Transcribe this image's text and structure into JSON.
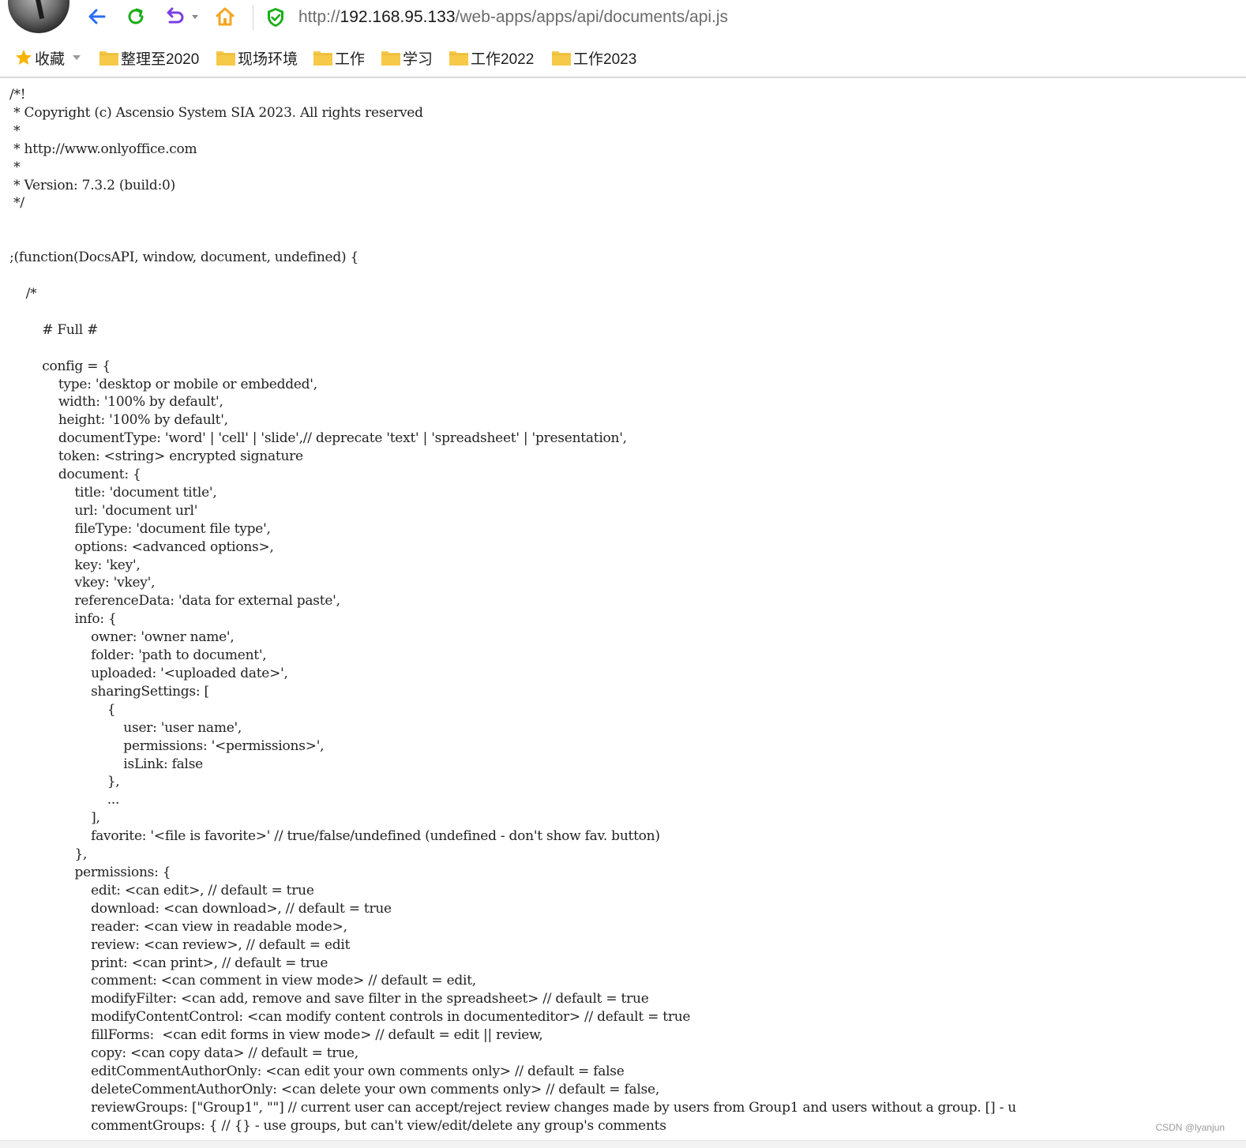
{
  "browser": {
    "url_scheme": "http://",
    "url_host": "192.168.95.133",
    "url_path": "/web-apps/apps/api/documents/api.js"
  },
  "bookmarks": {
    "favorites_label": "收藏",
    "items": [
      "整理至2020",
      "现场环境",
      "工作",
      "学习",
      "工作2022",
      "工作2023"
    ]
  },
  "colors": {
    "back": "#2a6df4",
    "refresh": "#1aad19",
    "undo": "#7b3fe4",
    "home": "#f5a623",
    "shield": "#1aad19",
    "folder": "#f7c948",
    "star": "#f7b500"
  },
  "source_lines": [
    "/*!",
    " * Copyright (c) Ascensio System SIA 2023. All rights reserved",
    " *",
    " * http://www.onlyoffice.com",
    " *",
    " * Version: 7.3.2 (build:0)",
    " */",
    "",
    "",
    ";(function(DocsAPI, window, document, undefined) {",
    "",
    "    /*",
    "",
    "        # Full #",
    "",
    "        config = {",
    "            type: 'desktop or mobile or embedded',",
    "            width: '100% by default',",
    "            height: '100% by default',",
    "            documentType: 'word' | 'cell' | 'slide',// deprecate 'text' | 'spreadsheet' | 'presentation',",
    "            token: <string> encrypted signature",
    "            document: {",
    "                title: 'document title',",
    "                url: 'document url'",
    "                fileType: 'document file type',",
    "                options: <advanced options>,",
    "                key: 'key',",
    "                vkey: 'vkey',",
    "                referenceData: 'data for external paste',",
    "                info: {",
    "                    owner: 'owner name',",
    "                    folder: 'path to document',",
    "                    uploaded: '<uploaded date>',",
    "                    sharingSettings: [",
    "                        {",
    "                            user: 'user name',",
    "                            permissions: '<permissions>',",
    "                            isLink: false",
    "                        },",
    "                        ...",
    "                    ],",
    "                    favorite: '<file is favorite>' // true/false/undefined (undefined - don't show fav. button)",
    "                },",
    "                permissions: {",
    "                    edit: <can edit>, // default = true",
    "                    download: <can download>, // default = true",
    "                    reader: <can view in readable mode>,",
    "                    review: <can review>, // default = edit",
    "                    print: <can print>, // default = true",
    "                    comment: <can comment in view mode> // default = edit,",
    "                    modifyFilter: <can add, remove and save filter in the spreadsheet> // default = true",
    "                    modifyContentControl: <can modify content controls in documenteditor> // default = true",
    "                    fillForms:  <can edit forms in view mode> // default = edit || review,",
    "                    copy: <can copy data> // default = true,",
    "                    editCommentAuthorOnly: <can edit your own comments only> // default = false",
    "                    deleteCommentAuthorOnly: <can delete your own comments only> // default = false,",
    "                    reviewGroups: [\"Group1\", \"\"] // current user can accept/reject review changes made by users from Group1 and users without a group. [] - u",
    "                    commentGroups: { // {} - use groups, but can't view/edit/delete any group's comments"
  ],
  "watermark": "CSDN @lyanjun"
}
